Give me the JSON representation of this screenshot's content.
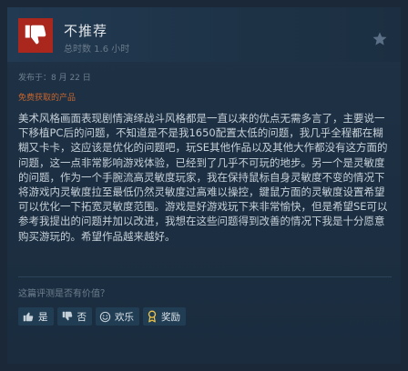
{
  "review": {
    "verdict": "不推荐",
    "playtime": "总时数 1.6 小时",
    "posted": "发布于：8 月 22 日",
    "product_tag": "免费获取的产品",
    "text": "美术风格画面表现剧情演绎战斗风格都是一直以来的优点无需多言了，主要说一下移植PC后的问题，不知道是不是我1650配置太低的问题，我几乎全程都在糊糊又卡卡，这应该是优化的问题吧，玩SE其他作品以及其他大作都没有这方面的问题，这一点非常影响游戏体验，已经到了几乎不可玩的地步。另一个是灵敏度的问题，作为一个手腕流高灵敏度玩家，我在保持鼠标自身灵敏度不变的情况下将游戏内灵敏度拉至最低仍然灵敏度过高难以操控，鍵鼠方面的灵敏度设置希望可以优化一下拓宽灵敏度范围。游戏是好游戏玩下来非常愉快，但是希望SE可以参考我提出的问题并加以改进，我想在这些问题得到改善的情况下我是十分愿意购买游玩的。希望作品越来越好。"
  },
  "feedback": {
    "question": "这篇评测是否有价值？",
    "yes_label": "是",
    "no_label": "否",
    "funny_label": "欢乐",
    "award_label": "奖励"
  },
  "colors": {
    "background": "#1b2838",
    "thumb_down_bg": "#a9271d",
    "product_tag": "#c7652c",
    "button_bg": "#203d54"
  },
  "icons": {
    "verdict": "thumbs-down-icon",
    "follow": "star-icon",
    "yes": "thumbs-up-icon",
    "no": "thumbs-down-icon",
    "funny": "smiley-icon",
    "award": "award-icon"
  }
}
